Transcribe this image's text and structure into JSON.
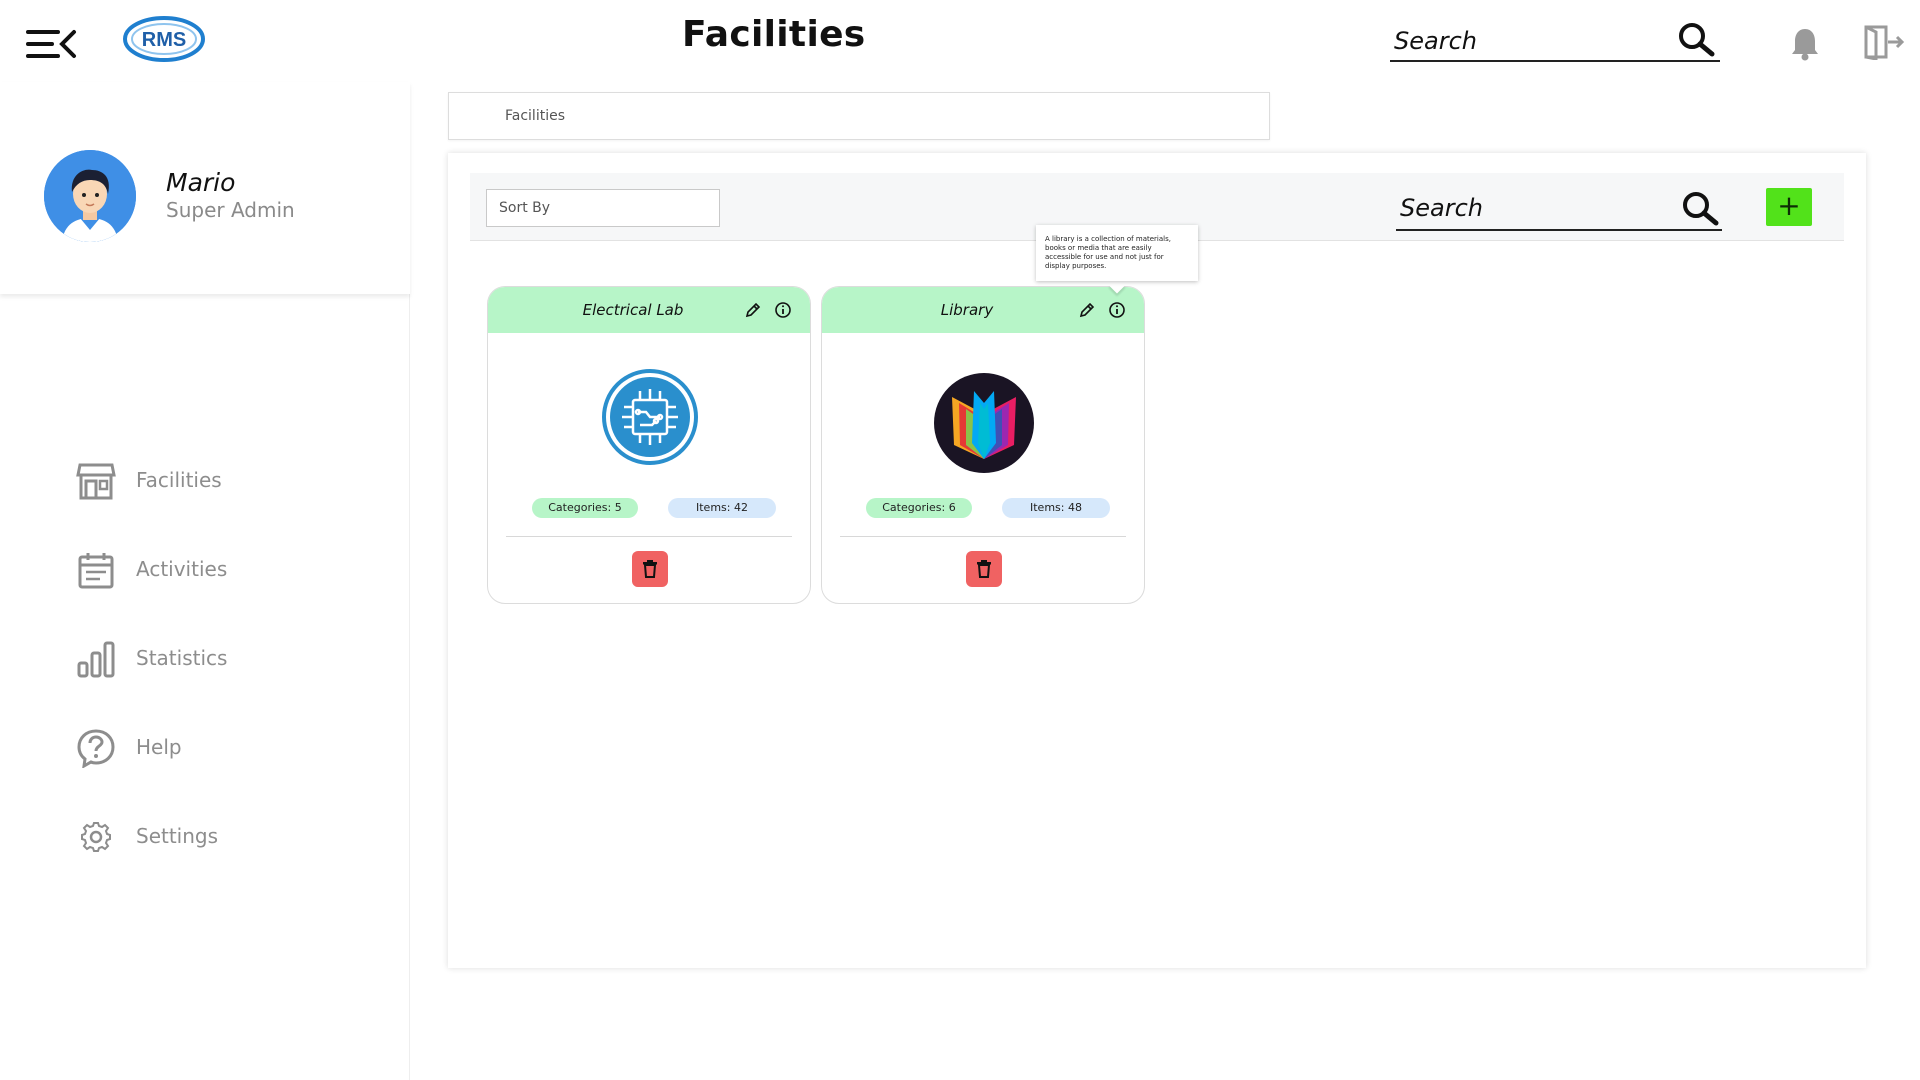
{
  "app": {
    "logo_text": "RMS",
    "title": "Facilities"
  },
  "header": {
    "search_placeholder": "Search"
  },
  "user": {
    "name": "Mario",
    "role": "Super Admin"
  },
  "nav": [
    {
      "label": "Facilities",
      "icon": "store-icon"
    },
    {
      "label": "Activities",
      "icon": "calendar-icon"
    },
    {
      "label": "Statistics",
      "icon": "bar-chart-icon"
    },
    {
      "label": "Help",
      "icon": "help-icon"
    },
    {
      "label": "Settings",
      "icon": "gear-icon"
    }
  ],
  "breadcrumb": "Facilities",
  "toolbar": {
    "sort_label": "Sort By",
    "search_placeholder": "Search",
    "add_label": "+"
  },
  "cards": [
    {
      "title": "Electrical Lab",
      "categories": "Categories: 5",
      "items": "Items: 42",
      "icon": "circuit-icon"
    },
    {
      "title": "Library",
      "categories": "Categories: 6",
      "items": "Items: 48",
      "icon": "book-icon"
    }
  ],
  "tooltip": "A library is a collection of materials, books or media that are easily accessible for use and not just for display purposes.",
  "colors": {
    "card_header": "#b7f5c8",
    "items_badge": "#d6e8fb",
    "add_button": "#52e21a",
    "delete_button": "#f06262",
    "avatar_bg": "#3f8fe6",
    "logo_blue": "#1f7fcf"
  }
}
